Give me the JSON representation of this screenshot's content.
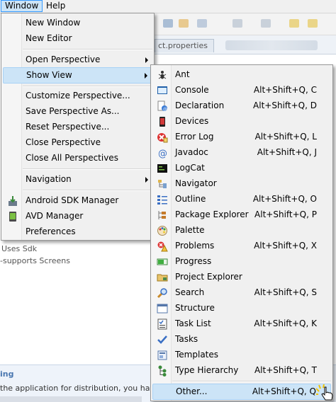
{
  "menubar": {
    "window": "Window",
    "help": "Help"
  },
  "editor_tab": {
    "label": "ct.properties"
  },
  "background": {
    "line1": "Uses Sdk",
    "line2": "-supports Screens",
    "bottom_heading": "ing",
    "bottom_desc": "the application for distribution, you hav"
  },
  "window_menu": {
    "items": [
      {
        "label": "New Window"
      },
      {
        "label": "New Editor"
      },
      {
        "label": "Open Perspective"
      },
      {
        "label": "Show View"
      },
      {
        "label": "Customize Perspective..."
      },
      {
        "label": "Save Perspective As..."
      },
      {
        "label": "Reset Perspective..."
      },
      {
        "label": "Close Perspective"
      },
      {
        "label": "Close All Perspectives"
      },
      {
        "label": "Navigation"
      },
      {
        "label": "Android SDK Manager"
      },
      {
        "label": "AVD Manager"
      },
      {
        "label": "Preferences"
      }
    ]
  },
  "show_view_menu": {
    "items": [
      {
        "label": "Ant",
        "shortcut": "",
        "icon": "ant-icon"
      },
      {
        "label": "Console",
        "shortcut": "Alt+Shift+Q, C",
        "icon": "console-icon"
      },
      {
        "label": "Declaration",
        "shortcut": "Alt+Shift+Q, D",
        "icon": "declaration-icon"
      },
      {
        "label": "Devices",
        "shortcut": "",
        "icon": "devices-icon"
      },
      {
        "label": "Error Log",
        "shortcut": "Alt+Shift+Q, L",
        "icon": "error-log-icon"
      },
      {
        "label": "Javadoc",
        "shortcut": "Alt+Shift+Q, J",
        "icon": "javadoc-icon"
      },
      {
        "label": "LogCat",
        "shortcut": "",
        "icon": "logcat-icon"
      },
      {
        "label": "Navigator",
        "shortcut": "",
        "icon": "navigator-icon"
      },
      {
        "label": "Outline",
        "shortcut": "Alt+Shift+Q, O",
        "icon": "outline-icon"
      },
      {
        "label": "Package Explorer",
        "shortcut": "Alt+Shift+Q, P",
        "icon": "package-explorer-icon"
      },
      {
        "label": "Palette",
        "shortcut": "",
        "icon": "palette-icon"
      },
      {
        "label": "Problems",
        "shortcut": "Alt+Shift+Q, X",
        "icon": "problems-icon"
      },
      {
        "label": "Progress",
        "shortcut": "",
        "icon": "progress-icon"
      },
      {
        "label": "Project Explorer",
        "shortcut": "",
        "icon": "project-explorer-icon"
      },
      {
        "label": "Search",
        "shortcut": "Alt+Shift+Q, S",
        "icon": "search-icon"
      },
      {
        "label": "Structure",
        "shortcut": "",
        "icon": "structure-icon"
      },
      {
        "label": "Task List",
        "shortcut": "Alt+Shift+Q, K",
        "icon": "task-list-icon"
      },
      {
        "label": "Tasks",
        "shortcut": "",
        "icon": "tasks-icon"
      },
      {
        "label": "Templates",
        "shortcut": "",
        "icon": "templates-icon"
      },
      {
        "label": "Type Hierarchy",
        "shortcut": "Alt+Shift+Q, T",
        "icon": "type-hierarchy-icon"
      },
      {
        "label": "Other...",
        "shortcut": "Alt+Shift+Q, Q",
        "icon": ""
      }
    ]
  },
  "colors": {
    "highlight": "#cce4f7",
    "highlight_border": "#a8d1f5",
    "menu_bg": "#f0f0f0"
  }
}
